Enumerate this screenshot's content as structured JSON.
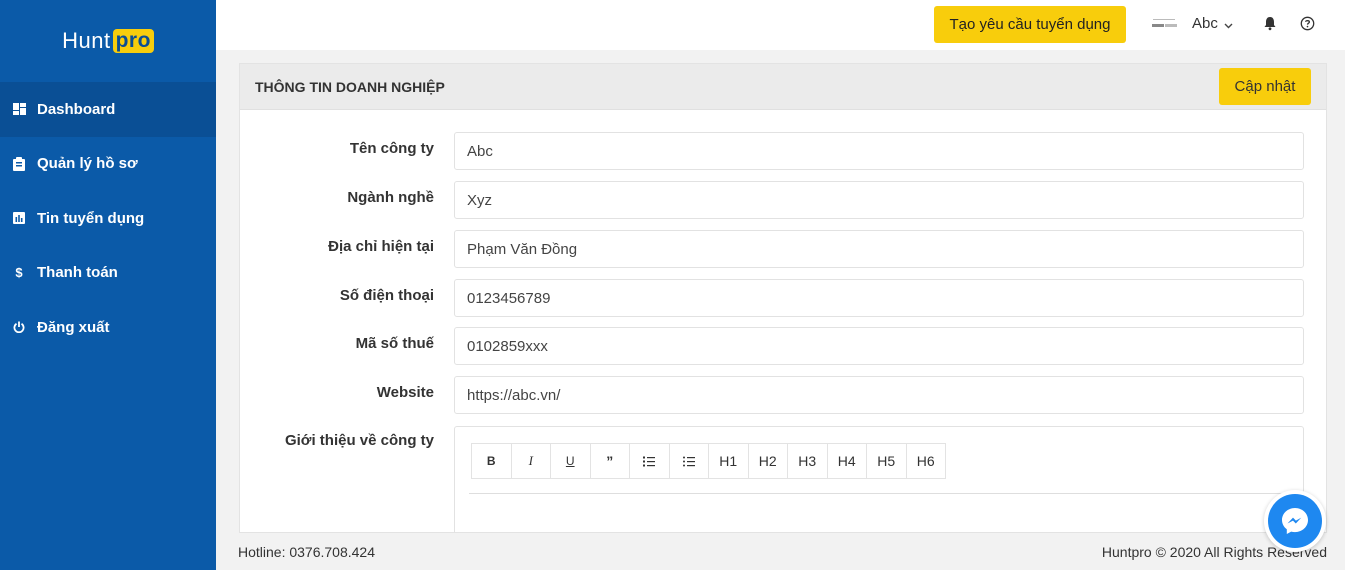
{
  "brand": {
    "name_a": "Hunt",
    "name_b": "pro"
  },
  "sidebar": {
    "items": [
      {
        "label": "Dashboard",
        "icon": "dashboard-icon",
        "active": true
      },
      {
        "label": "Quản lý hồ sơ",
        "icon": "clipboard-icon"
      },
      {
        "label": "Tin tuyển dụng",
        "icon": "chart-icon"
      },
      {
        "label": "Thanh toán",
        "icon": "dollar-icon"
      },
      {
        "label": "Đăng xuất",
        "icon": "power-icon"
      }
    ]
  },
  "topbar": {
    "create_label": "Tạo yêu cầu tuyển dụng",
    "user": "Abc"
  },
  "panel": {
    "title": "THÔNG TIN DOANH NGHIỆP",
    "update_label": "Cập nhật",
    "fields": [
      {
        "label": "Tên công ty",
        "value": "Abc"
      },
      {
        "label": "Ngành nghề",
        "value": "Xyz"
      },
      {
        "label": "Địa chỉ hiện tại",
        "value": "Phạm Văn Đồng"
      },
      {
        "label": "Số điện thoại",
        "value": "0123456789"
      },
      {
        "label": "Mã số thuế",
        "value": "0102859xxx"
      },
      {
        "label": "Website",
        "value": "https://abc.vn/"
      }
    ],
    "intro_label": "Giới thiệu về công ty",
    "toolbar": [
      "B",
      "I",
      "U",
      "”",
      "ordered-list-icon",
      "bullet-list-icon",
      "H1",
      "H2",
      "H3",
      "H4",
      "H5",
      "H6"
    ]
  },
  "footer": {
    "hotline": "Hotline: 0376.708.424",
    "copyright": "Huntpro © 2020 All Rights Reserved"
  },
  "colors": {
    "sidebar": "#0b5aa8",
    "accent": "#f8cd0c",
    "messenger": "#1e88f0"
  }
}
